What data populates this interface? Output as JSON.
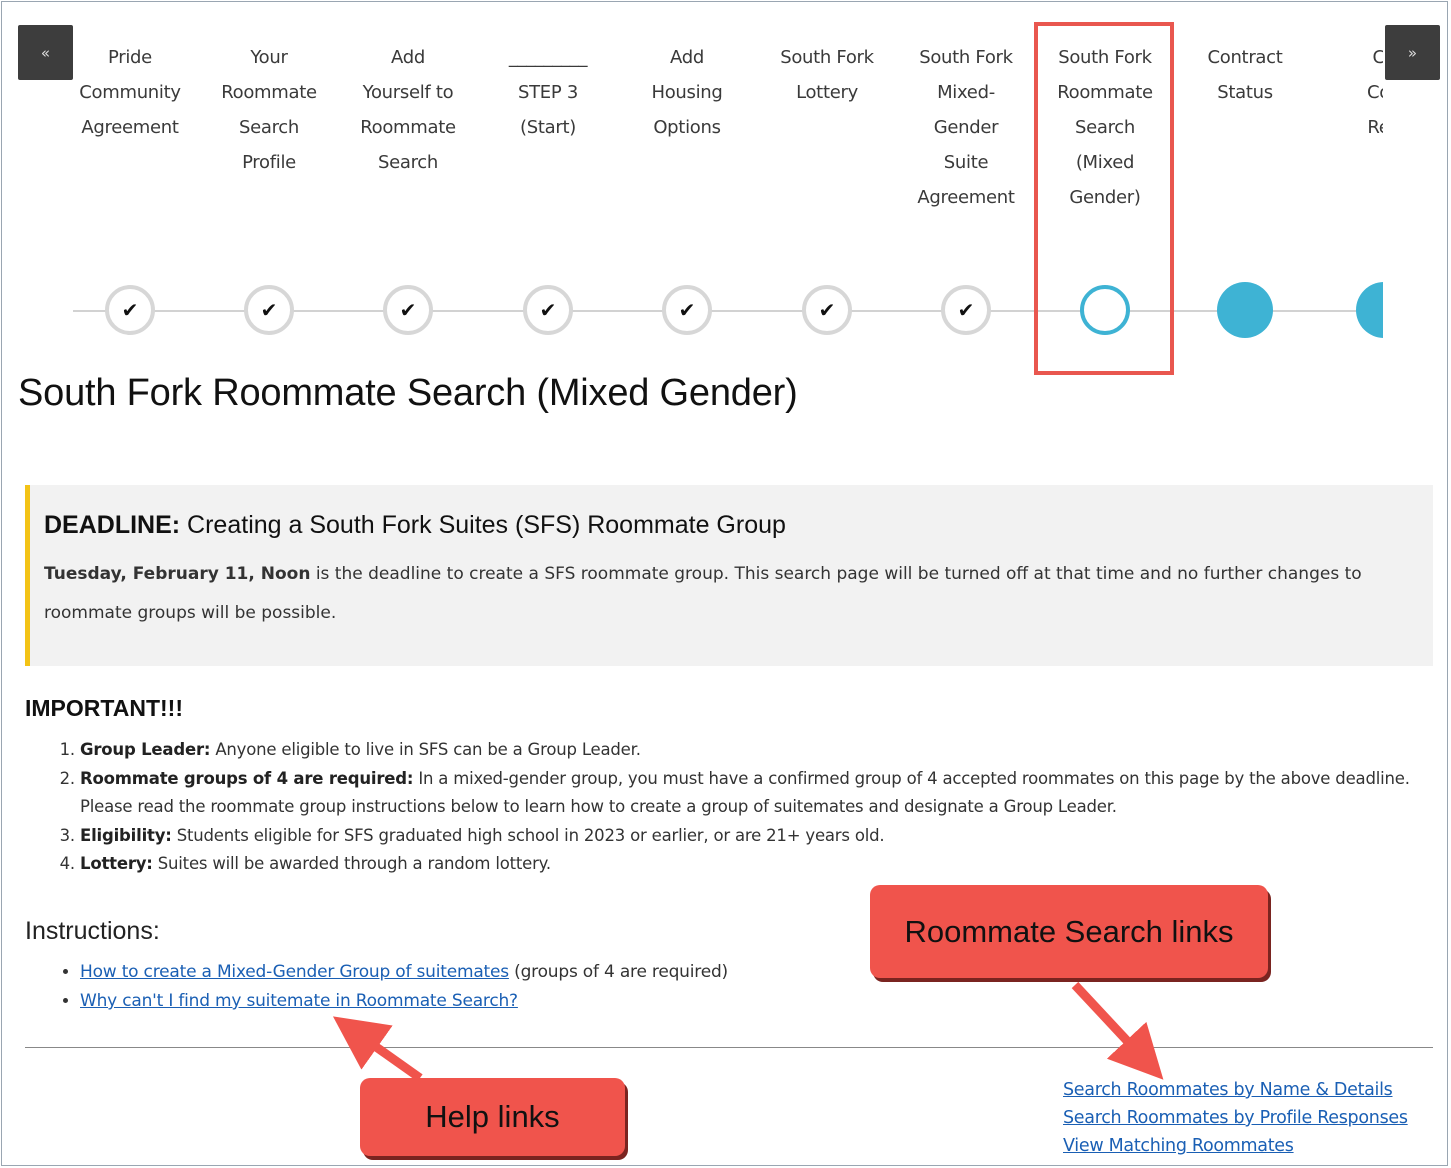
{
  "stepper": {
    "prev_label": "«",
    "next_label": "»",
    "check_glyph": "✔",
    "steps": [
      {
        "lines": [
          "Pride",
          "Community",
          "Agreement"
        ],
        "state": "complete"
      },
      {
        "lines": [
          "Your",
          "Roommate",
          "Search",
          "Profile"
        ],
        "state": "complete"
      },
      {
        "lines": [
          "Add",
          "Yourself to",
          "Roommate",
          "Search"
        ],
        "state": "complete"
      },
      {
        "lines": [
          "_________",
          "STEP 3",
          "(Start)"
        ],
        "state": "complete"
      },
      {
        "lines": [
          "Add",
          "Housing",
          "Options"
        ],
        "state": "complete"
      },
      {
        "lines": [
          "South Fork",
          "Lottery"
        ],
        "state": "complete"
      },
      {
        "lines": [
          "South Fork",
          "Mixed-",
          "Gender",
          "Suite",
          "Agreement"
        ],
        "state": "complete"
      },
      {
        "lines": [
          "South Fork",
          "Roommate",
          "Search",
          "(Mixed",
          "Gender)"
        ],
        "state": "current"
      },
      {
        "lines": [
          "Contract",
          "Status"
        ],
        "state": "future"
      },
      {
        "lines": [
          "Ca",
          "Con",
          "Req"
        ],
        "state": "partial"
      }
    ]
  },
  "page_title": "South Fork Roommate Search (Mixed Gender)",
  "deadline": {
    "label": "DEADLINE:",
    "heading": " Creating a South Fork Suites (SFS) Roommate Group",
    "date_text": "Tuesday, February 11, Noon",
    "body": " is the deadline to create a SFS roommate group. This search page will be turned off at that time and no further changes to roommate groups will be possible."
  },
  "important": {
    "heading": "IMPORTANT!!!",
    "items": [
      {
        "label": "Group Leader:",
        "text": " Anyone eligible to live in SFS can be a Group Leader."
      },
      {
        "label": "Roommate groups of 4 are required:",
        "text": " In a mixed-gender group, you must have a confirmed group of 4 accepted roommates on this page by the above deadline. Please read the roommate group instructions below to learn how to create a group of suitemates and designate a Group Leader."
      },
      {
        "label": "Eligibility:",
        "text": " Students eligible for SFS graduated high school in 2023 or earlier, or are 21+ years old."
      },
      {
        "label": "Lottery:",
        "text": " Suites will be awarded through a random lottery."
      }
    ]
  },
  "instructions": {
    "heading": "Instructions:",
    "link1": "How to create a Mixed-Gender Group of suitemates",
    "link1_suffix": " (groups of 4 are required)",
    "link2": "Why can't I find my suitemate in Roommate Search?"
  },
  "search_links": {
    "by_name": "Search Roommates by Name & Details",
    "by_profile": "Search Roommates by Profile Responses",
    "matching": "View Matching Roommates"
  },
  "callouts": {
    "search": "Roommate Search links",
    "help": "Help links",
    "color": "#f0544c"
  },
  "colors": {
    "accent": "#3eb3d4",
    "highlight": "#e9574f",
    "deadline_bar": "#f3c316",
    "link": "#1a5fb4"
  }
}
